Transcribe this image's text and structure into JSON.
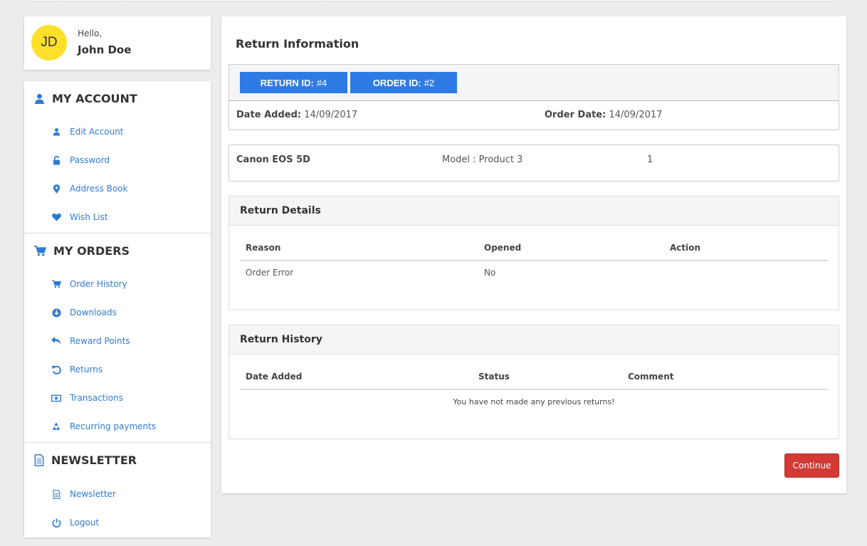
{
  "user": {
    "initials": "JD",
    "greeting": "Hello,",
    "name": "John Doe"
  },
  "sidebar": {
    "sections": [
      {
        "title": "MY ACCOUNT",
        "icon": "user-icon",
        "items": [
          {
            "label": "Edit Account",
            "icon": "user-icon"
          },
          {
            "label": "Password",
            "icon": "unlock-icon"
          },
          {
            "label": "Address Book",
            "icon": "map-marker-icon"
          },
          {
            "label": "Wish List",
            "icon": "heart-icon"
          }
        ]
      },
      {
        "title": "MY ORDERS",
        "icon": "cart-icon",
        "items": [
          {
            "label": "Order History",
            "icon": "cart-icon"
          },
          {
            "label": "Downloads",
            "icon": "download-circle-icon"
          },
          {
            "label": "Reward Points",
            "icon": "reply-icon"
          },
          {
            "label": "Returns",
            "icon": "undo-icon"
          },
          {
            "label": "Transactions",
            "icon": "money-icon"
          },
          {
            "label": "Recurring payments",
            "icon": "recycle-icon"
          }
        ]
      },
      {
        "title": "NEWSLETTER",
        "icon": "document-icon",
        "items": [
          {
            "label": "Newsletter",
            "icon": "document-icon"
          },
          {
            "label": "Logout",
            "icon": "power-icon"
          }
        ]
      }
    ]
  },
  "main": {
    "title": "Return Information",
    "return_id_label": "RETURN ID:",
    "return_id": "#4",
    "order_id_label": "ORDER ID:",
    "order_id": "#2",
    "date_added_label": "Date Added:",
    "date_added": "14/09/2017",
    "order_date_label": "Order Date:",
    "order_date": "14/09/2017",
    "product": {
      "name": "Canon EOS 5D",
      "model": "Model : Product 3",
      "quantity": "1"
    },
    "return_details": {
      "title": "Return Details",
      "headers": [
        "Reason",
        "Opened",
        "Action"
      ],
      "rows": [
        {
          "reason": "Order Error",
          "opened": "No",
          "action": ""
        }
      ]
    },
    "return_history": {
      "title": "Return History",
      "headers": [
        "Date Added",
        "Status",
        "Comment"
      ],
      "empty_text": "You have not made any previous returns!"
    },
    "continue_label": "Continue"
  },
  "colors": {
    "accent": "#2f7be6",
    "link": "#2f7bd4",
    "danger": "#d33a33",
    "avatar": "#fde02a"
  }
}
